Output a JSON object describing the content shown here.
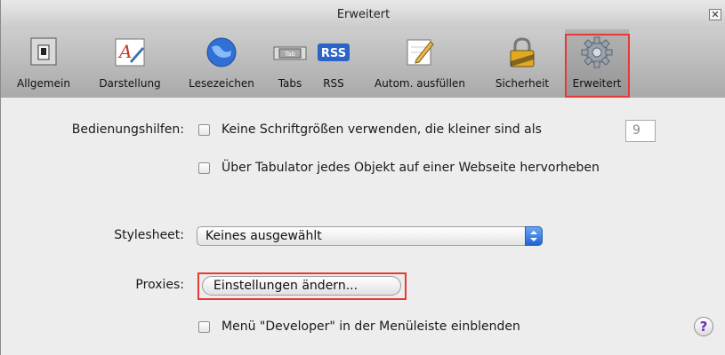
{
  "window": {
    "title": "Erweitert",
    "close_symbol": "✕"
  },
  "toolbar": {
    "items": [
      {
        "label": "Allgemein",
        "icon": "switch-icon"
      },
      {
        "label": "Darstellung",
        "icon": "font-icon"
      },
      {
        "label": "Lesezeichen",
        "icon": "globe-icon"
      },
      {
        "label": "Tabs",
        "icon": "tabs-icon",
        "icon_text": "Tab"
      },
      {
        "label": "RSS",
        "icon": "rss-icon",
        "icon_text": "RSS"
      },
      {
        "label": "Autom. ausfüllen",
        "icon": "pencil-icon"
      },
      {
        "label": "Sicherheit",
        "icon": "lock-icon"
      },
      {
        "label": "Erweitert",
        "icon": "gear-icon",
        "selected": true
      }
    ]
  },
  "accessibility": {
    "label": "Bedienungshilfen:",
    "min_font_text": "Keine Schriftgrößen verwenden, die kleiner sind als",
    "min_font_value": "9",
    "tab_highlight_text": "Über Tabulator jedes Objekt auf einer Webseite hervorheben"
  },
  "stylesheet": {
    "label": "Stylesheet:",
    "value": "Keines ausgewählt"
  },
  "proxies": {
    "label": "Proxies:",
    "button": "Einstellungen ändern..."
  },
  "developer": {
    "text": "Menü \"Developer\" in der Menüleiste einblenden"
  },
  "help": {
    "symbol": "?"
  },
  "colors": {
    "highlight": "#e53935",
    "select_accent": "#2f74de"
  }
}
